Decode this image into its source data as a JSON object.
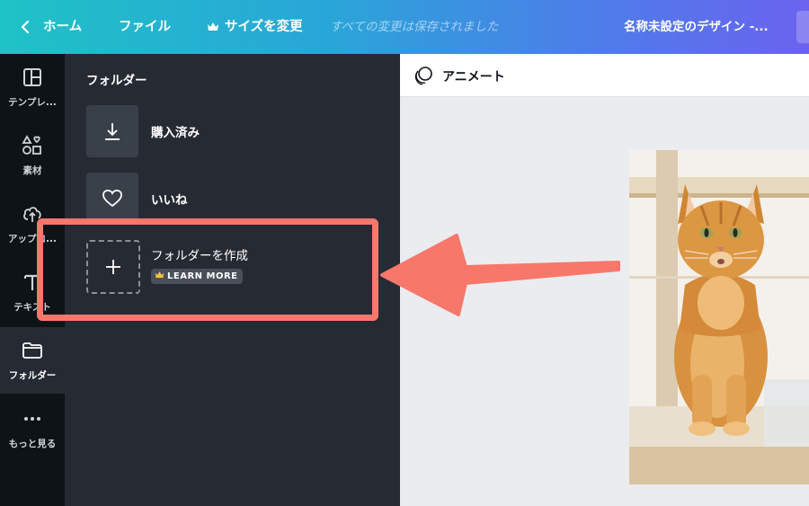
{
  "topbar": {
    "back_label": "ホーム",
    "file_label": "ファイル",
    "resize_label": "サイズを変更",
    "saved_status": "すべての変更は保存されました",
    "doc_name": "名称未設定のデザイン -..."
  },
  "rail": {
    "items": [
      {
        "label": "テンプレ...",
        "icon": "template-icon"
      },
      {
        "label": "素材",
        "icon": "elements-icon"
      },
      {
        "label": "アップロ...",
        "icon": "upload-icon"
      },
      {
        "label": "テキスト",
        "icon": "text-icon"
      },
      {
        "label": "フォルダー",
        "icon": "folder-icon",
        "active": true
      },
      {
        "label": "もっと見る",
        "icon": "more-icon"
      }
    ]
  },
  "panel": {
    "title": "フォルダー",
    "folders": [
      {
        "name": "購入済み",
        "icon": "download-icon"
      },
      {
        "name": "いいね",
        "icon": "heart-icon"
      }
    ],
    "create_folder": {
      "name": "フォルダーを作成",
      "badge": "LEARN MORE",
      "icon": "plus-icon"
    }
  },
  "canvas": {
    "toolbar_label": "アニメート",
    "image": "orange-tabby-cat-photo"
  },
  "colors": {
    "accent_gradient_start": "#1fc2c6",
    "accent_gradient_end": "#6b63ef",
    "annotation": "#f7786b",
    "panel_bg": "#262b33",
    "rail_bg": "#0e1318"
  }
}
